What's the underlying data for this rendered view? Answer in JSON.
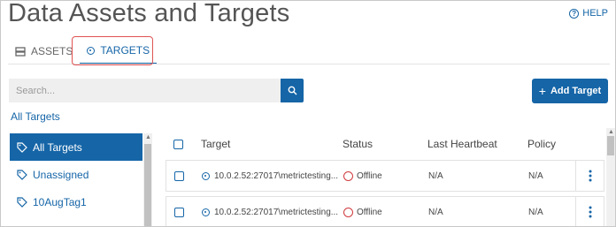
{
  "header": {
    "title": "Data Assets and Targets",
    "help_label": "HELP",
    "help_icon": "help-circle-icon"
  },
  "tabs": [
    {
      "label": "ASSETS",
      "icon": "server-icon",
      "active": false
    },
    {
      "label": "TARGETS",
      "icon": "target-icon",
      "active": true
    }
  ],
  "search": {
    "placeholder": "Search...",
    "value": ""
  },
  "toolbar": {
    "add_target_label": "Add Target",
    "add_icon": "plus"
  },
  "breadcrumb": {
    "label": "All Targets"
  },
  "sidebar": {
    "items": [
      {
        "label": "All Targets",
        "icon": "tag-icon",
        "active": true
      },
      {
        "label": "Unassigned",
        "icon": "tag-icon",
        "active": false
      },
      {
        "label": "10AugTag1",
        "icon": "tag-icon",
        "active": false
      }
    ]
  },
  "table": {
    "columns": {
      "target": "Target",
      "status": "Status",
      "last_heartbeat": "Last Heartbeat",
      "policy": "Policy"
    },
    "rows": [
      {
        "target": "10.0.2.52:27017\\metrictesting...",
        "status": "Offline",
        "last_heartbeat": "N/A",
        "policy": "N/A"
      },
      {
        "target": "10.0.2.52:27017\\metrictesting...",
        "status": "Offline",
        "last_heartbeat": "N/A",
        "policy": "N/A"
      }
    ]
  },
  "colors": {
    "accent": "#1565a7",
    "offline": "#d0393e",
    "highlight_box": "#e05252"
  }
}
